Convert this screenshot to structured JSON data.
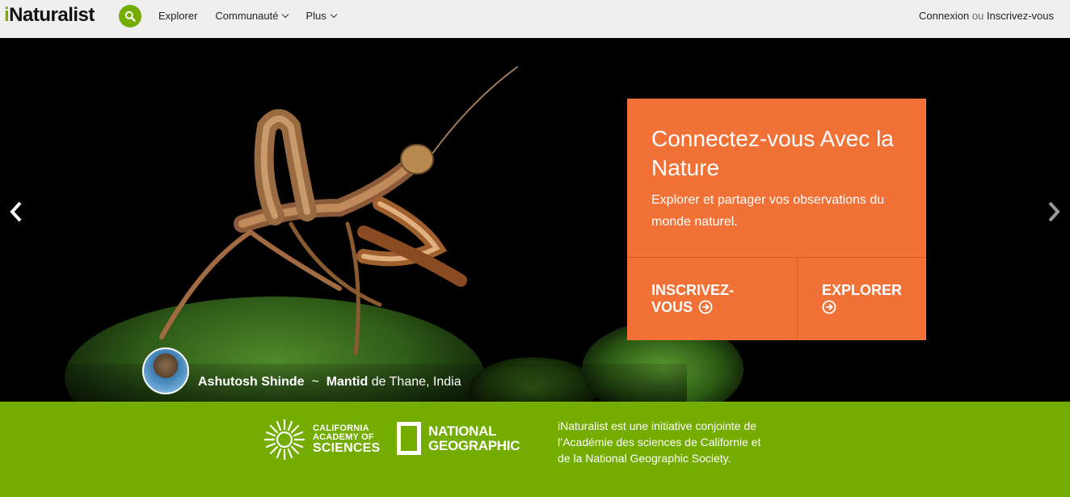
{
  "header": {
    "logo_prefix": "i",
    "logo_rest": "Naturalist",
    "nav": [
      {
        "label": "Explorer"
      },
      {
        "label": "Communauté"
      },
      {
        "label": "Plus"
      }
    ],
    "login": "Connexion",
    "or": "ou",
    "signup": "Inscrivez-vous"
  },
  "hero": {
    "card": {
      "title": "Connectez-vous Avec la Nature",
      "subtitle": "Explorer et partager vos observations du monde naturel.",
      "signup_line1": "INSCRIVEZ-",
      "signup_line2": "VOUS",
      "explore": "EXPLORER"
    },
    "credit": {
      "photographer": "Ashutosh Shinde",
      "separator": "~",
      "taxon": "Mantid",
      "location": "de Thane, India"
    }
  },
  "footer": {
    "cas_line1": "CALIFORNIA",
    "cas_line2": "ACADEMY OF",
    "cas_line3": "SCIENCES",
    "ng_line1": "NATIONAL",
    "ng_line2": "GEOGRAPHIC",
    "text": "iNaturalist est une initiative conjointe de l’Académie des sciences de Californie et de la National Geographic Society."
  },
  "colors": {
    "brand_green": "#74ac00",
    "card_orange": "#f27137",
    "header_bg": "#efefef"
  },
  "icons": [
    "search-icon",
    "chevron-down-icon",
    "chevron-left-icon",
    "chevron-right-icon",
    "arrow-circle-right-icon"
  ]
}
